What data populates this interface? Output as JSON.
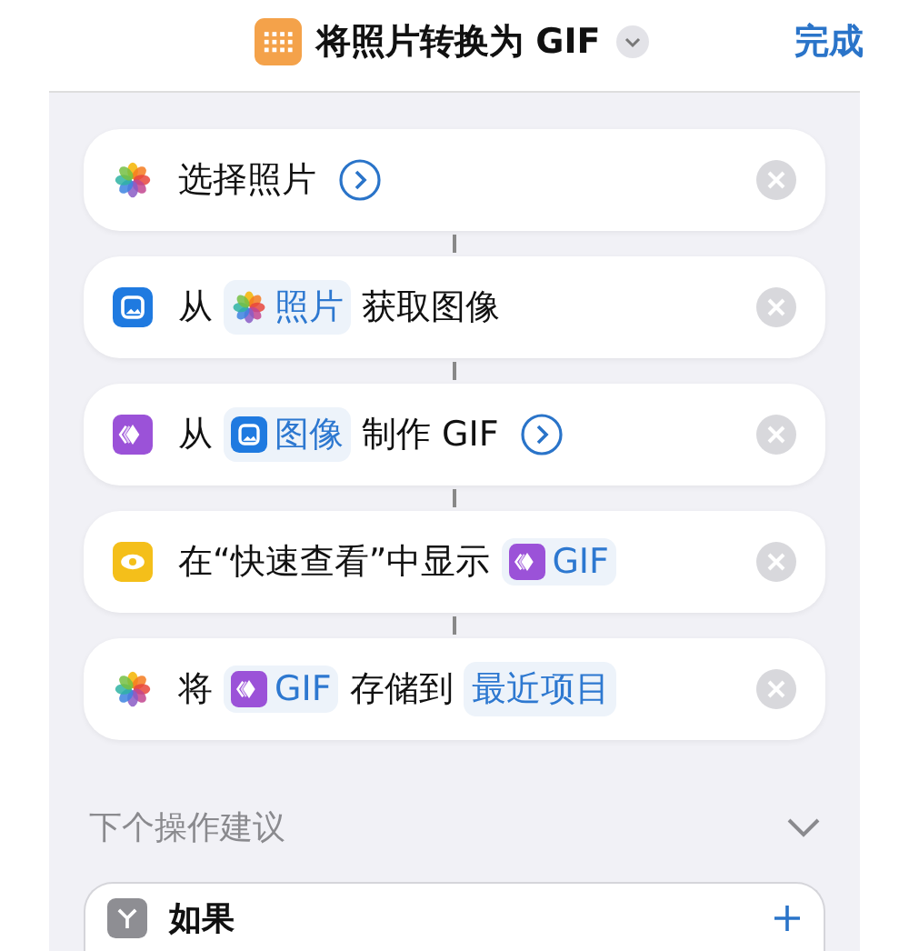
{
  "header": {
    "title": "将照片转换为 GIF",
    "done": "完成"
  },
  "actions": [
    {
      "kind": "photos",
      "parts": [
        {
          "kind": "text",
          "text": "选择照片"
        },
        {
          "kind": "expand"
        }
      ]
    },
    {
      "kind": "image",
      "parts": [
        {
          "kind": "text",
          "text": "从"
        },
        {
          "kind": "photo",
          "text": "照片"
        },
        {
          "kind": "text",
          "text": "获取图像"
        }
      ]
    },
    {
      "kind": "gif",
      "parts": [
        {
          "kind": "text",
          "text": "从"
        },
        {
          "kind": "image",
          "text": "图像"
        },
        {
          "kind": "text",
          "text": "制作 GIF"
        },
        {
          "kind": "expand"
        }
      ]
    },
    {
      "kind": "quicklook",
      "parts": [
        {
          "kind": "text",
          "text": "在“快速查看”中显示"
        },
        {
          "kind": "gif",
          "text": "GIF"
        }
      ]
    },
    {
      "kind": "photos",
      "parts": [
        {
          "kind": "text",
          "text": "将"
        },
        {
          "kind": "gif",
          "text": "GIF"
        },
        {
          "kind": "text",
          "text": "存储到"
        },
        {
          "kind": "value",
          "text": "最近项目"
        }
      ]
    }
  ],
  "suggestions": {
    "title": "下个操作建议",
    "expanded": true,
    "items": [
      {
        "kind": "condition",
        "label": "如果"
      }
    ]
  }
}
